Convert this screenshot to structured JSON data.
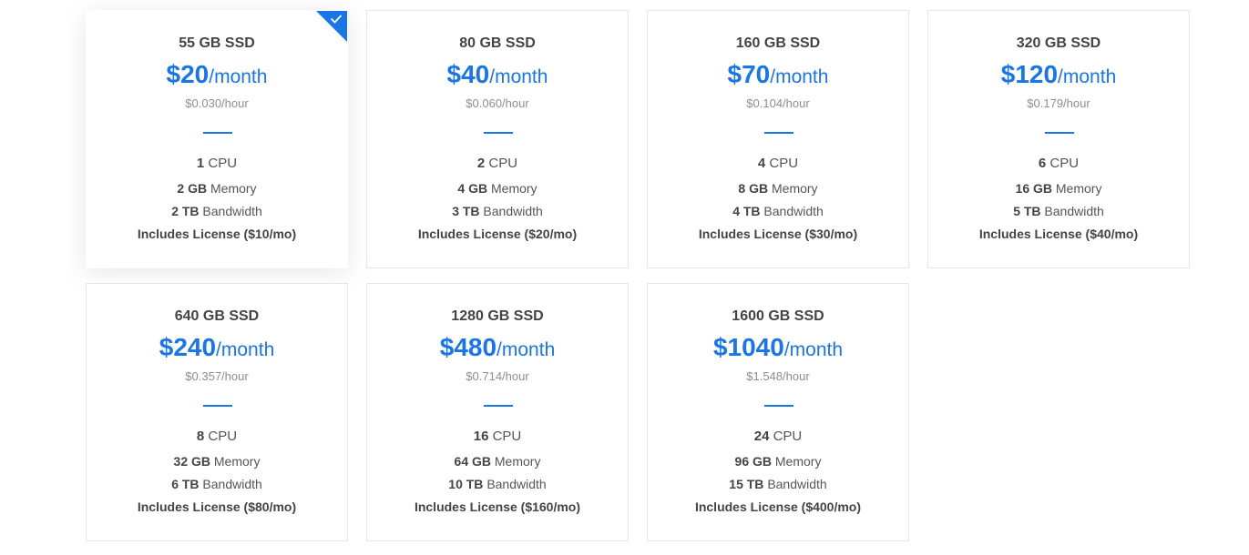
{
  "colors": {
    "accent": "#1a75e6",
    "heading": "#444444",
    "muted": "#8b8e94",
    "border": "#e4e6ea"
  },
  "selected_plan_index": 0,
  "plans": [
    {
      "storage": "55 GB SSD",
      "price": "$20",
      "period": "/month",
      "hourly": "$0.030/hour",
      "cpu_count": "1",
      "cpu_label": "CPU",
      "memory": "2 GB",
      "memory_label": "Memory",
      "bandwidth": "2 TB",
      "bandwidth_label": "Bandwidth",
      "license": "Includes License ($10/mo)"
    },
    {
      "storage": "80 GB SSD",
      "price": "$40",
      "period": "/month",
      "hourly": "$0.060/hour",
      "cpu_count": "2",
      "cpu_label": "CPU",
      "memory": "4 GB",
      "memory_label": "Memory",
      "bandwidth": "3 TB",
      "bandwidth_label": "Bandwidth",
      "license": "Includes License ($20/mo)"
    },
    {
      "storage": "160 GB SSD",
      "price": "$70",
      "period": "/month",
      "hourly": "$0.104/hour",
      "cpu_count": "4",
      "cpu_label": "CPU",
      "memory": "8 GB",
      "memory_label": "Memory",
      "bandwidth": "4 TB",
      "bandwidth_label": "Bandwidth",
      "license": "Includes License ($30/mo)"
    },
    {
      "storage": "320 GB SSD",
      "price": "$120",
      "period": "/month",
      "hourly": "$0.179/hour",
      "cpu_count": "6",
      "cpu_label": "CPU",
      "memory": "16 GB",
      "memory_label": "Memory",
      "bandwidth": "5 TB",
      "bandwidth_label": "Bandwidth",
      "license": "Includes License ($40/mo)"
    },
    {
      "storage": "640 GB SSD",
      "price": "$240",
      "period": "/month",
      "hourly": "$0.357/hour",
      "cpu_count": "8",
      "cpu_label": "CPU",
      "memory": "32 GB",
      "memory_label": "Memory",
      "bandwidth": "6 TB",
      "bandwidth_label": "Bandwidth",
      "license": "Includes License ($80/mo)"
    },
    {
      "storage": "1280 GB SSD",
      "price": "$480",
      "period": "/month",
      "hourly": "$0.714/hour",
      "cpu_count": "16",
      "cpu_label": "CPU",
      "memory": "64 GB",
      "memory_label": "Memory",
      "bandwidth": "10 TB",
      "bandwidth_label": "Bandwidth",
      "license": "Includes License ($160/mo)"
    },
    {
      "storage": "1600 GB SSD",
      "price": "$1040",
      "period": "/month",
      "hourly": "$1.548/hour",
      "cpu_count": "24",
      "cpu_label": "CPU",
      "memory": "96 GB",
      "memory_label": "Memory",
      "bandwidth": "15 TB",
      "bandwidth_label": "Bandwidth",
      "license": "Includes License ($400/mo)"
    }
  ],
  "icons": {
    "selected_marker": "check-icon"
  }
}
